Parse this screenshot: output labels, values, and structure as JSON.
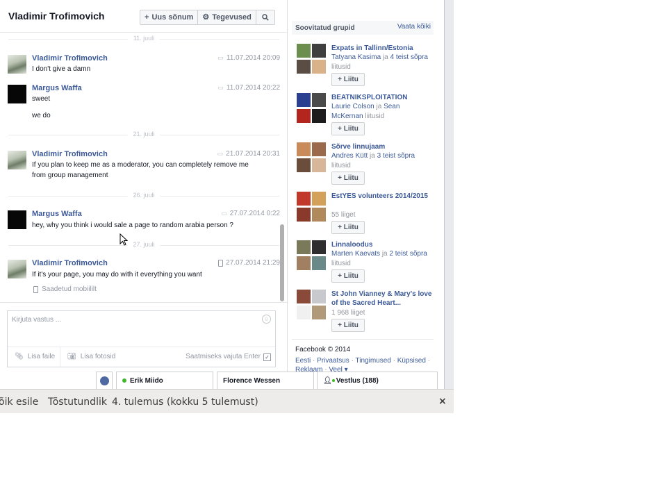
{
  "header": {
    "title": "Vladimir Trofimovich",
    "new_message": "Uus sõnum",
    "actions": "Tegevused"
  },
  "thread": {
    "dividers": [
      "11. juuli",
      "21. juuli",
      "26. juuli",
      "27. juuli"
    ],
    "messages": [
      {
        "author": "Vladimir Trofimovich",
        "time": "11.07.2014 20:09",
        "lines": [
          "I don't give a damn"
        ]
      },
      {
        "author": "Margus Waffa",
        "time": "11.07.2014 20:22",
        "lines": [
          "sweet",
          "we do"
        ]
      },
      {
        "author": "Vladimir Trofimovich",
        "time": "21.07.2014 20:31",
        "lines": [
          "If you plan to keep me as a moderator, you can completely remove me from group management"
        ]
      },
      {
        "author": "Margus Waffa",
        "time": "27.07.2014 0:22",
        "lines": [
          "hey, why you think i would sale a page to random arabia person ?"
        ]
      },
      {
        "author": "Vladimir Trofimovich",
        "time": "27.07.2014 21:29",
        "lines": [
          "If it's your page, you may do with it everything you want"
        ]
      }
    ],
    "sent_mobile": "Saadetud mobiililt"
  },
  "reply": {
    "placeholder": "Kirjuta vastus ...",
    "add_file": "Lisa faile",
    "add_photos": "Lisa fotosid",
    "enter_hint": "Saatmiseks vajuta Enter"
  },
  "sidebar": {
    "title": "Soovitatud grupid",
    "see_all": "Vaata kõiki",
    "groups": [
      {
        "name": "Expats in Tallinn/Estonia",
        "friend": "Tatyana Kasima",
        "mid": " ja ",
        "others": "4 teist sõpra",
        "tail": " liitusid",
        "colors": [
          "#6b8e4e",
          "#3f3f3f",
          "#5a4d44",
          "#d9b28a"
        ]
      },
      {
        "name": "BEATNIKSPLOITATION",
        "friend": "Laurie Colson",
        "mid": " ja ",
        "others": "Sean McKernan",
        "tail": " liitusid",
        "colors": [
          "#2a3f8f",
          "#4a4a4a",
          "#b3261e",
          "#1c1c1c"
        ]
      },
      {
        "name": "Sõrve linnujaam",
        "friend": "Andres Kütt",
        "mid": " ja ",
        "others": "3 teist sõpra",
        "tail": " liitusid",
        "colors": [
          "#c98b5a",
          "#9a6a4a",
          "#6a4d3a",
          "#d8b69a"
        ]
      },
      {
        "name": "EstYES volunteers 2014/2015",
        "members": "55 liiget",
        "colors": [
          "#c0392b",
          "#d4a15a",
          "#8a3a2a",
          "#b08a5a"
        ]
      },
      {
        "name": "Linnaloodus",
        "friend": "Marten Kaevats",
        "mid": " ja ",
        "others": "2 teist sõpra",
        "tail": " liitusid",
        "colors": [
          "#7a7a5a",
          "#2e2e2e",
          "#a08060",
          "#6a8a8a"
        ]
      },
      {
        "name": "St John Vianney & Mary's love of the Sacred Heart...",
        "members": "1 968 liiget",
        "colors": [
          "#8a4a3a",
          "#c7c9cc",
          "#f0f0f0",
          "#b09a7a"
        ]
      }
    ],
    "join_label": "Liitu",
    "footer_copy": "Facebook © 2014",
    "footer_links": [
      "Eesti",
      "Privaatsus",
      "Tingimused",
      "Küpsised",
      "Reklaam",
      "Veel"
    ]
  },
  "chatbar": {
    "tab1": "Erik Miido",
    "tab2": "Florence Wessen",
    "chat": "Vestlus (188)"
  },
  "findbar": {
    "highlight_all": "õik esile",
    "match_case": "Tõstutundlik",
    "result": "4. tulemus (kokku 5 tulemust)"
  }
}
